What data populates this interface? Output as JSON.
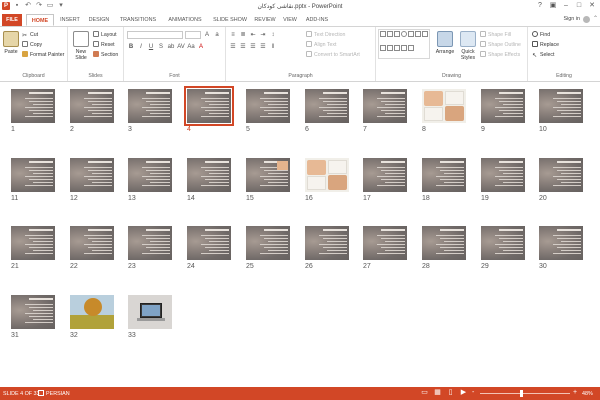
{
  "window": {
    "title": "نقاشی کودکان.pptx - PowerPoint",
    "controls": [
      "?",
      "restore-icon",
      "minimize-icon",
      "maximize-icon",
      "close-icon"
    ]
  },
  "tabs": {
    "file": "FILE",
    "items": [
      "HOME",
      "INSERT",
      "DESIGN",
      "TRANSITIONS",
      "ANIMATIONS",
      "SLIDE SHOW",
      "REVIEW",
      "VIEW",
      "ADD-INS"
    ],
    "active": "HOME",
    "signin": "Sign in"
  },
  "ribbon": {
    "clipboard": {
      "label": "Clipboard",
      "paste": "Paste",
      "cut": "Cut",
      "copy": "Copy",
      "format_painter": "Format Painter"
    },
    "slides": {
      "label": "Slides",
      "new_slide": "New",
      "new_slide2": "Slide",
      "layout": "Layout",
      "reset": "Reset",
      "section": "Section"
    },
    "font": {
      "label": "Font"
    },
    "paragraph": {
      "label": "Paragraph",
      "text_direction": "Text Direction",
      "align_text": "Align Text",
      "convert_smartart": "Convert to SmartArt"
    },
    "drawing": {
      "label": "Drawing",
      "arrange": "Arrange",
      "quick_styles": "Quick",
      "quick_styles2": "Styles",
      "shape_fill": "Shape Fill",
      "shape_outline": "Shape Outline",
      "shape_effects": "Shape Effects"
    },
    "editing": {
      "label": "Editing",
      "find": "Find",
      "replace": "Replace",
      "select": "Select"
    }
  },
  "slides": {
    "total": 33,
    "selected": 4,
    "numbers": [
      "1",
      "2",
      "3",
      "4",
      "5",
      "6",
      "7",
      "8",
      "9",
      "10",
      "11",
      "12",
      "13",
      "14",
      "15",
      "16",
      "17",
      "18",
      "19",
      "20",
      "21",
      "22",
      "23",
      "24",
      "25",
      "26",
      "27",
      "28",
      "29",
      "30",
      "31",
      "32",
      "33"
    ]
  },
  "status": {
    "slide_indicator": "SLIDE 4 OF 33",
    "language": "PERSIAN",
    "zoom_minus": "-",
    "zoom_plus": "+",
    "zoom": "48%"
  },
  "colors": {
    "accent": "#d24726",
    "thumb_bg": "#77716f"
  }
}
